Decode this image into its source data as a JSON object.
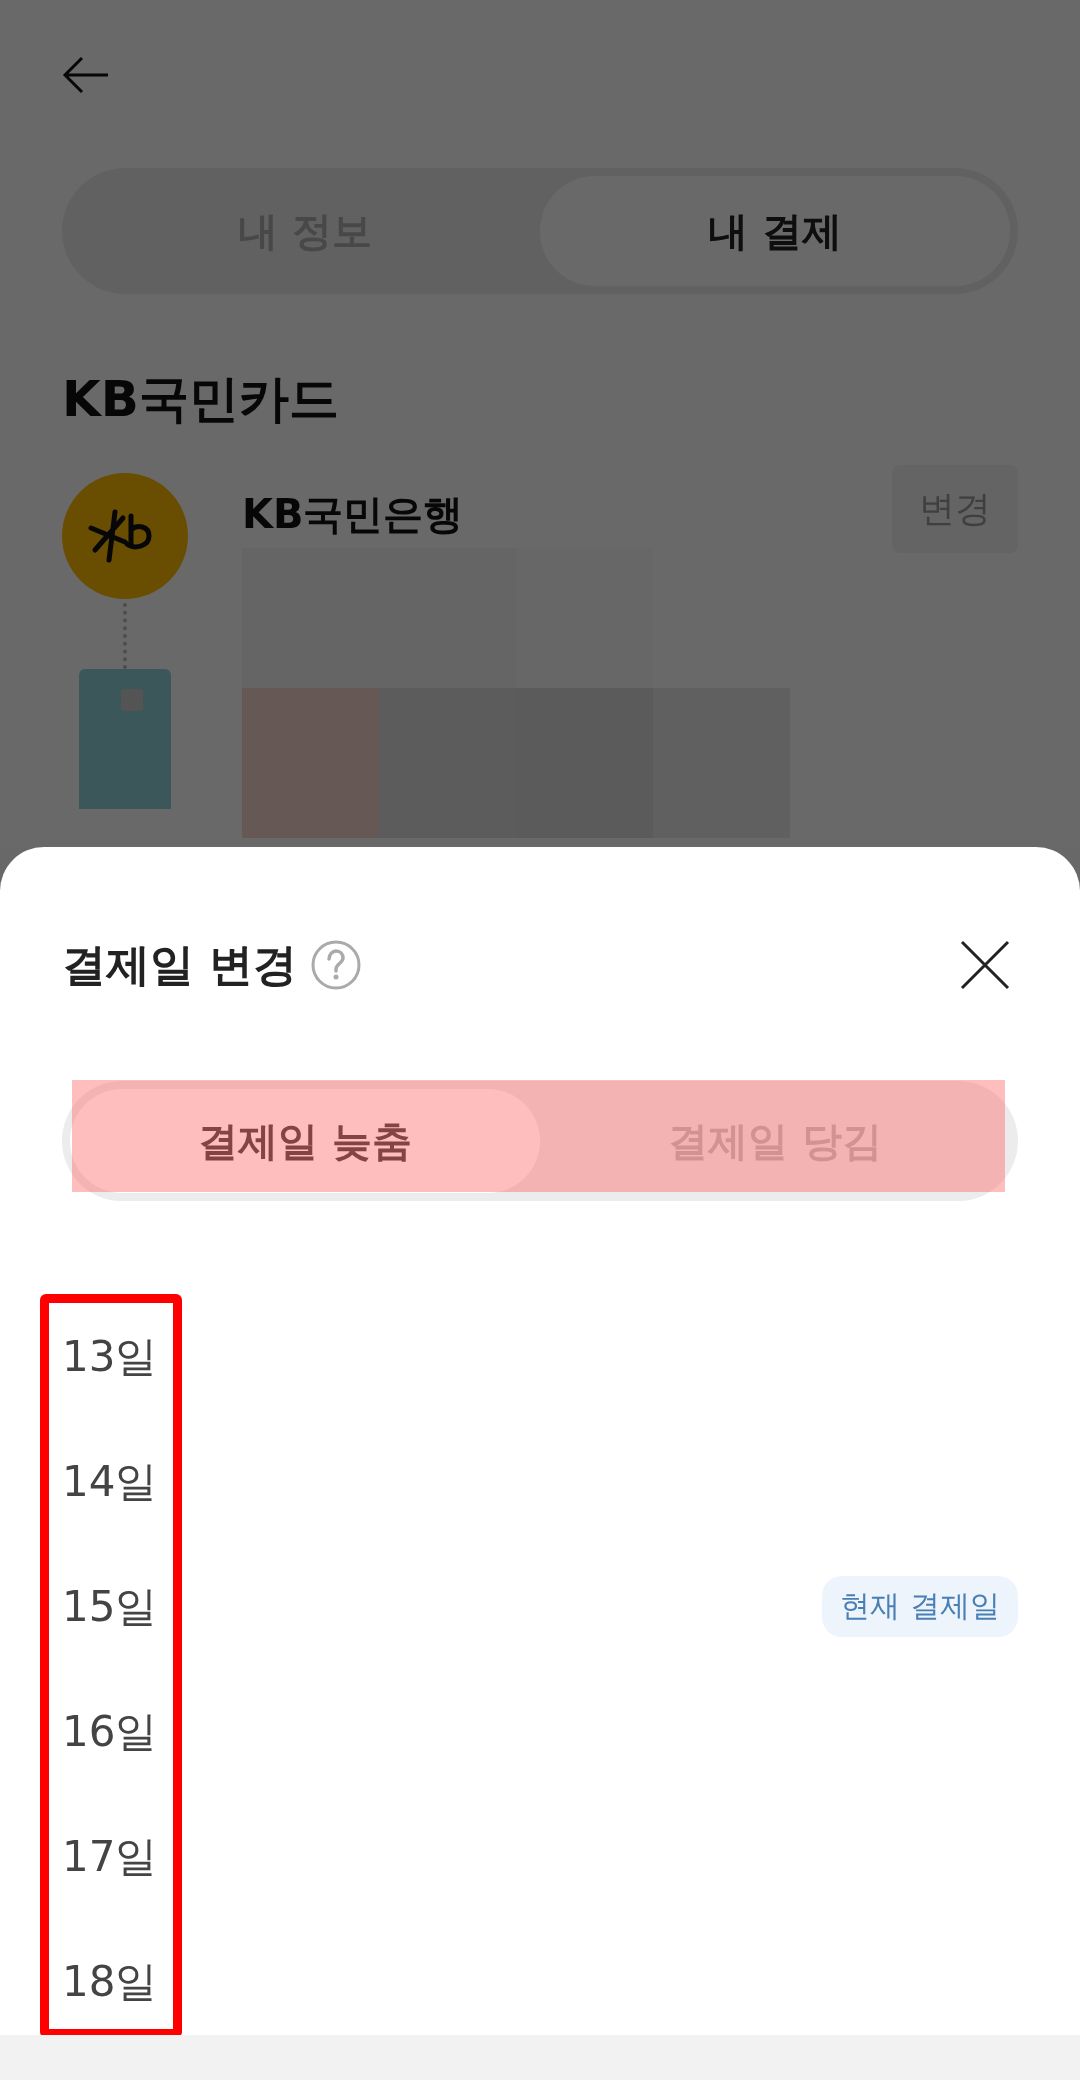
{
  "page": {
    "tabs": [
      {
        "label": "내 정보",
        "selected": false
      },
      {
        "label": "내 결제",
        "selected": true
      }
    ],
    "card_company": "KB국민카드",
    "account": {
      "bank": "KB국민은행",
      "change_button": "변경"
    }
  },
  "sheet": {
    "title": "결제일 변경",
    "tabs": [
      {
        "label": "결제일 늦춤",
        "selected": true
      },
      {
        "label": "결제일 당김",
        "selected": false
      }
    ],
    "days": [
      {
        "label": "13일"
      },
      {
        "label": "14일"
      },
      {
        "label": "15일",
        "badge": "현재 결제일"
      },
      {
        "label": "16일"
      },
      {
        "label": "17일"
      },
      {
        "label": "18일"
      }
    ]
  }
}
